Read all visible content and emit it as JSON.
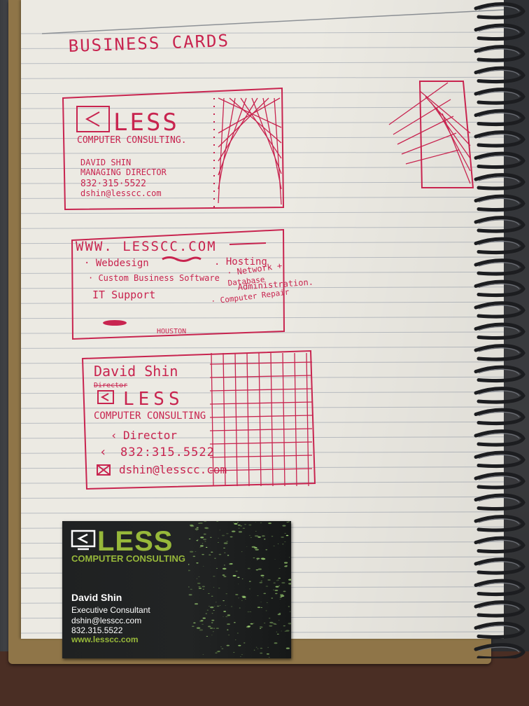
{
  "notebook": {
    "heading": "BUSINESS  CARDS",
    "sketch_front": {
      "brand": "LESS",
      "tagline": "COMPUTER CONSULTING.",
      "name": "DAVID SHIN",
      "title": "MANAGING DIRECTOR",
      "phone": "832·315·5522",
      "email": "dshin@lesscc.com"
    },
    "sketch_back": {
      "url": "WWW. LESSCC.COM",
      "services": [
        "· Webdesign",
        "· Custom Business Software",
        "IT Support",
        ". Hosting",
        "· Network +",
        "Database",
        "Administration.",
        "· Computer Repair"
      ],
      "city": "HOUSTON"
    },
    "sketch_alt": {
      "name": "David Shin",
      "struck": "Director",
      "brand": "LESS",
      "tagline": "COMPUTER CONSULTING",
      "title": "Director",
      "phone": "832:315.5522",
      "email": "dshin@lesscc.com"
    }
  },
  "business_card": {
    "brand": "LESS",
    "tagline": "COMPUTER CONSULTING",
    "name": "David Shin",
    "title": "Executive Consultant",
    "email": "dshin@lesscc.com",
    "phone": "832.315.5522",
    "website": "www.lesscc.com"
  },
  "colors": {
    "ink": "#c8244f",
    "paper": "#eceae3",
    "rule_line": "#b9bdc2",
    "card_bg": "#1f2122",
    "card_accent": "#97b83a"
  }
}
